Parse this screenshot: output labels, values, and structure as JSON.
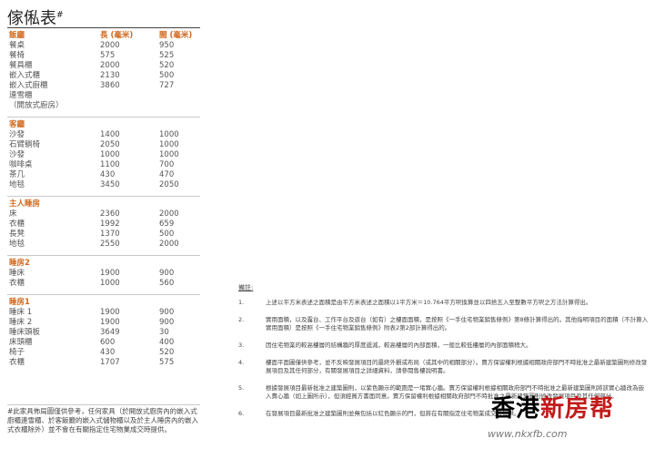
{
  "title": "傢俬表",
  "title_mark": "#",
  "sections": [
    {
      "name": "飯廳",
      "length_header": "長 (毫米)",
      "width_header": "闊 (毫米)",
      "items": [
        {
          "name": "餐桌",
          "length": "2000",
          "width": "950"
        },
        {
          "name": "餐椅",
          "length": "575",
          "width": "525"
        },
        {
          "name": "餐具櫃",
          "length": "2000",
          "width": "520"
        },
        {
          "name": "嵌入式櫃",
          "length": "2130",
          "width": "500"
        },
        {
          "name": "嵌入式廚櫃",
          "length": "3860",
          "width": "727"
        },
        {
          "name": "連雪櫃",
          "length": "",
          "width": ""
        },
        {
          "name": "（開放式廚房）",
          "length": "",
          "width": ""
        }
      ]
    },
    {
      "name": "客廳",
      "items": [
        {
          "name": "沙發",
          "length": "1400",
          "width": "1000"
        },
        {
          "name": "石臂躺椅",
          "length": "2050",
          "width": "1000"
        },
        {
          "name": "沙發",
          "length": "1000",
          "width": "1000"
        },
        {
          "name": "咖啡桌",
          "length": "1100",
          "width": "700"
        },
        {
          "name": "茶几",
          "length": "430",
          "width": "470"
        },
        {
          "name": "地毯",
          "length": "3450",
          "width": "2050"
        }
      ]
    },
    {
      "name": "主人睡房",
      "items": [
        {
          "name": "床",
          "length": "2360",
          "width": "2000"
        },
        {
          "name": "衣櫃",
          "length": "1992",
          "width": "659"
        },
        {
          "name": "長凳",
          "length": "1370",
          "width": "500"
        },
        {
          "name": "地毯",
          "length": "2550",
          "width": "2000"
        }
      ]
    },
    {
      "name": "睡房2",
      "items": [
        {
          "name": "睡床",
          "length": "1900",
          "width": "900"
        },
        {
          "name": "衣櫃",
          "length": "1000",
          "width": "560"
        }
      ]
    },
    {
      "name": "睡房1",
      "items": [
        {
          "name": "睡床 1",
          "length": "1900",
          "width": "900"
        },
        {
          "name": "睡床 2",
          "length": "1900",
          "width": "900"
        },
        {
          "name": "睡床頭板",
          "length": "3649",
          "width": "30"
        },
        {
          "name": "床頭櫃",
          "length": "600",
          "width": "400"
        },
        {
          "name": "椅子",
          "length": "430",
          "width": "520"
        },
        {
          "name": "衣櫃",
          "length": "1707",
          "width": "575"
        }
      ]
    }
  ],
  "footnote": "#此家具佈局圖僅供參考，任何家具（於開放式廚房內的嵌入式廚櫃連雪櫃、於客飯廳的嵌入式儲物櫃以及於主人睡房內的嵌入式衣櫃除外）並不會在有關指定住宅物業成交時提供。",
  "notes": {
    "title": "備註:",
    "items": [
      {
        "num": "1.",
        "text": "上述以平方米表述之面積是由平方米表述之面積以1平方米＝10.764平方呎換算並以四捨五入至整數平方呎之方法計算得出。"
      },
      {
        "num": "2.",
        "text": "實用面積，以及露台、工作平台及遊台（如有）之樓面面積，是按照《一手住宅物業銷售條例》第8條計算得出的。其他指明項目的面積（不計算入實用面積）是按照《一手住宅物業銷售條例》附表2第2部計算得出的。"
      },
      {
        "num": "3.",
        "text": "因住宅物業的較高樓層的結構牆的厚度遞減，較高樓層的內部面積，一般比較低樓層的內部面積稍大。"
      },
      {
        "num": "4.",
        "text": "樓面平面圖僅供參考，並不反映發展項目的最終外觀或布局（或其中的相關部分）。賣方保留權利根據相關政府部門不時批准之最新建築圖則修改發展項目及其任何部分，有關發展項目之詳細資料，請參閱售樓說明書。"
      },
      {
        "num": "5.",
        "text": "根據發展項目最新批准之建築圖則，以紫色顯示的範圍是一堵實心牆。賣方保留權利根據相關政府部門不時批准之最新建築圖則將該實心牆改為嵌入賣心牆（如上圖所示），但須經買方書面同意。賣方保留權利根據相關政府部門不時批准之最新建築圖則修改發展項目及其任何部分。"
      },
      {
        "num": "6.",
        "text": "在發展項目最新批准之建築圖則並無包括以紅色顯示的門，但將在有關指定住宅物業成交時提供。"
      }
    ]
  },
  "watermark": {
    "part1": "香港",
    "part2": "新房",
    "part3": "帮",
    "url": "www.nkxfb.com",
    "color_dark": "#000000",
    "color_red": "#c21a1a"
  }
}
